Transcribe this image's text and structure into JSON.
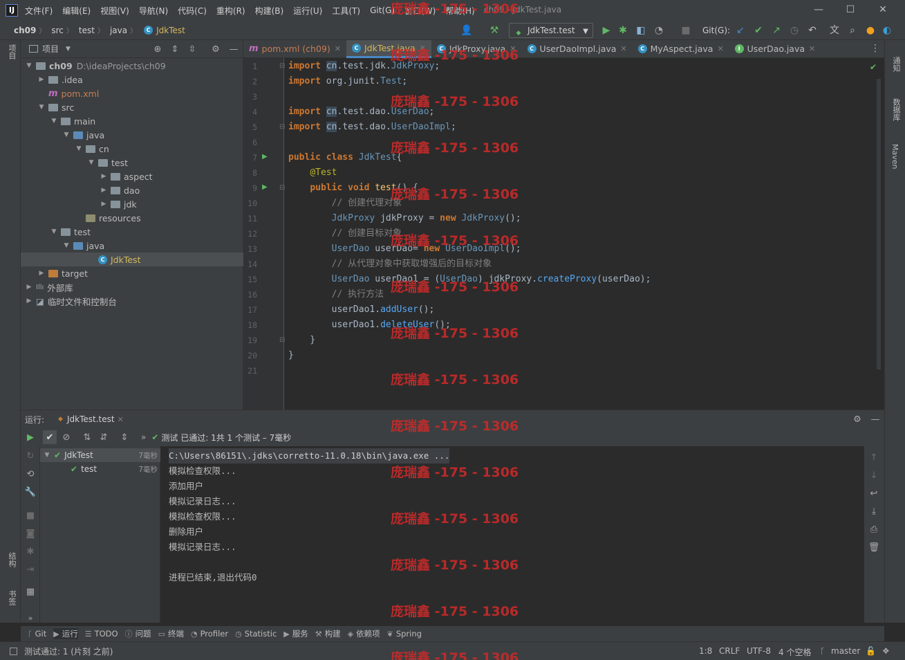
{
  "app": {
    "logo": "IJ",
    "window_title": "ch09 - JdkTest.java",
    "menu": [
      "文件(F)",
      "编辑(E)",
      "视图(V)",
      "导航(N)",
      "代码(C)",
      "重构(R)",
      "构建(B)",
      "运行(U)",
      "工具(T)",
      "Git(G)",
      "窗口(W)",
      "帮助(H)"
    ]
  },
  "nav": {
    "breadcrumbs": [
      "ch09",
      "src",
      "test",
      "java",
      "JdkTest"
    ],
    "run_config": "JdkTest.test",
    "git_label": "Git(G):"
  },
  "left_strip": {
    "project": "项目",
    "structure": "结构",
    "bookmarks": "书签"
  },
  "right_strip": {
    "notifications": "通知",
    "database": "数据库",
    "maven": "Maven"
  },
  "project": {
    "title": "项目",
    "tree": [
      {
        "label": "ch09",
        "extra": "D:\\ideaProjects\\ch09",
        "indent": 0,
        "arrow": "open",
        "icon": "folder"
      },
      {
        "label": ".idea",
        "indent": 1,
        "arrow": "closed",
        "icon": "folder"
      },
      {
        "label": "pom.xml",
        "indent": 1,
        "arrow": "",
        "icon": "maven"
      },
      {
        "label": "src",
        "indent": 1,
        "arrow": "open",
        "icon": "folder"
      },
      {
        "label": "main",
        "indent": 2,
        "arrow": "open",
        "icon": "folder"
      },
      {
        "label": "java",
        "indent": 3,
        "arrow": "open",
        "icon": "folder-blue"
      },
      {
        "label": "cn",
        "indent": 4,
        "arrow": "open",
        "icon": "folder"
      },
      {
        "label": "test",
        "indent": 5,
        "arrow": "open",
        "icon": "folder"
      },
      {
        "label": "aspect",
        "indent": 6,
        "arrow": "closed",
        "icon": "folder"
      },
      {
        "label": "dao",
        "indent": 6,
        "arrow": "closed",
        "icon": "folder"
      },
      {
        "label": "jdk",
        "indent": 6,
        "arrow": "closed",
        "icon": "folder"
      },
      {
        "label": "resources",
        "indent": 4,
        "arrow": "",
        "icon": "folder-res"
      },
      {
        "label": "test",
        "indent": 2,
        "arrow": "open",
        "icon": "folder"
      },
      {
        "label": "java",
        "indent": 3,
        "arrow": "open",
        "icon": "folder-blue"
      },
      {
        "label": "JdkTest",
        "indent": 5,
        "arrow": "",
        "icon": "class",
        "selected": true
      },
      {
        "label": "target",
        "indent": 1,
        "arrow": "closed",
        "icon": "folder-orange"
      },
      {
        "label": "外部库",
        "indent": 0,
        "arrow": "closed",
        "icon": "library"
      },
      {
        "label": "临时文件和控制台",
        "indent": 0,
        "arrow": "closed",
        "icon": "scratch"
      }
    ]
  },
  "tabs": [
    {
      "label": "pom.xml (ch09)",
      "icon": "m",
      "active": false
    },
    {
      "label": "JdkTest.java",
      "icon": "c",
      "active": true
    },
    {
      "label": "JdkProxy.java",
      "icon": "c",
      "active": false
    },
    {
      "label": "UserDaoImpl.java",
      "icon": "c",
      "active": false
    },
    {
      "label": "MyAspect.java",
      "icon": "c",
      "active": false
    },
    {
      "label": "UserDao.java",
      "icon": "i",
      "active": false
    }
  ],
  "code_lines": [
    "1",
    "2",
    "3",
    "4",
    "5",
    "6",
    "7",
    "8",
    "9",
    "10",
    "11",
    "12",
    "13",
    "14",
    "15",
    "16",
    "17",
    "18",
    "19",
    "20",
    "21"
  ],
  "watermark": "庞瑞鑫 -175 - 1306",
  "run": {
    "label": "运行:",
    "tab": "JdkTest.test",
    "status": "测试 已通过: 1共 1 个测试 – 7毫秒",
    "tests": [
      {
        "name": "JdkTest",
        "time": "7毫秒"
      },
      {
        "name": "test",
        "time": "7毫秒"
      }
    ],
    "console": [
      "C:\\Users\\86151\\.jdks\\corretto-11.0.18\\bin\\java.exe ...",
      "模拟检查权限...",
      "添加用户",
      "模拟记录日志...",
      "模拟检查权限...",
      "删除用户",
      "模拟记录日志...",
      "",
      "进程已结束,退出代码0"
    ]
  },
  "bottom_tools": [
    {
      "label": "Git",
      "icon": "git-icon"
    },
    {
      "label": "运行",
      "icon": "run-icon"
    },
    {
      "label": "TODO",
      "icon": "todo-icon"
    },
    {
      "label": "问题",
      "icon": "problems-icon"
    },
    {
      "label": "终端",
      "icon": "terminal-icon"
    },
    {
      "label": "Profiler",
      "icon": "profiler-icon"
    },
    {
      "label": "Statistic",
      "icon": "statistic-icon"
    },
    {
      "label": "服务",
      "icon": "services-icon"
    },
    {
      "label": "构建",
      "icon": "build-icon"
    },
    {
      "label": "依赖项",
      "icon": "dependencies-icon"
    },
    {
      "label": "Spring",
      "icon": "spring-icon"
    }
  ],
  "status": {
    "message": "测试通过: 1 (片刻 之前)",
    "position": "1:8",
    "line_sep": "CRLF",
    "encoding": "UTF-8",
    "indent": "4 个空格",
    "branch": "master"
  }
}
